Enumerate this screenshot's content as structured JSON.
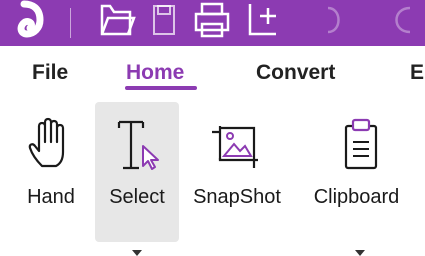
{
  "accent_color": "#8c3bb2",
  "quick_access": {
    "icons": [
      "app-logo-icon",
      "open-folder-icon",
      "save-icon",
      "print-icon",
      "new-window-icon",
      "undo-icon",
      "redo-icon"
    ]
  },
  "tabs": [
    {
      "label": "File",
      "active": false
    },
    {
      "label": "Home",
      "active": true
    },
    {
      "label": "Convert",
      "active": false
    },
    {
      "label": "E",
      "active": false
    }
  ],
  "ribbon": {
    "hand": {
      "label": "Hand",
      "icon": "hand-icon"
    },
    "select": {
      "label": "Select",
      "icon": "text-cursor-select-icon",
      "has_dropdown": true,
      "selected": true
    },
    "snapshot": {
      "label": "SnapShot",
      "icon": "snapshot-icon"
    },
    "clipboard": {
      "label": "Clipboard",
      "icon": "clipboard-icon",
      "has_dropdown": true
    }
  }
}
